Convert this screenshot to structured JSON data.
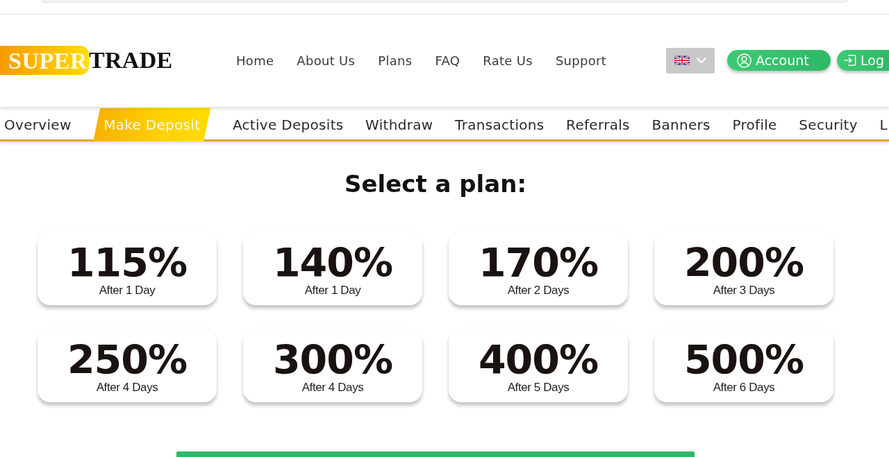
{
  "logo": {
    "highlight": "SUPER",
    "rest": "TRADE"
  },
  "nav": [
    "Home",
    "About Us",
    "Plans",
    "FAQ",
    "Rate Us",
    "Support"
  ],
  "buttons": [
    {
      "label": "Account",
      "kind": "account"
    },
    {
      "label": "Log",
      "kind": "login"
    }
  ],
  "tabs": [
    {
      "label": "Overview",
      "selected": false
    },
    {
      "label": "Make Deposit",
      "selected": true
    },
    {
      "label": "Active Deposits",
      "selected": false
    },
    {
      "label": "Withdraw",
      "selected": false
    },
    {
      "label": "Transactions",
      "selected": false
    },
    {
      "label": "Referrals",
      "selected": false
    },
    {
      "label": "Banners",
      "selected": false
    },
    {
      "label": "Profile",
      "selected": false
    },
    {
      "label": "Security",
      "selected": false
    },
    {
      "label": "L",
      "selected": false
    }
  ],
  "title": "Select a plan:",
  "plans": [
    {
      "rate": "115%",
      "term": "After 1 Day"
    },
    {
      "rate": "140%",
      "term": "After 1 Day"
    },
    {
      "rate": "170%",
      "term": "After 2 Days"
    },
    {
      "rate": "200%",
      "term": "After 3 Days"
    },
    {
      "rate": "250%",
      "term": "After 4 Days"
    },
    {
      "rate": "300%",
      "term": "After 4 Days"
    },
    {
      "rate": "400%",
      "term": "After 5 Days"
    },
    {
      "rate": "500%",
      "term": "After 6 Days"
    }
  ]
}
